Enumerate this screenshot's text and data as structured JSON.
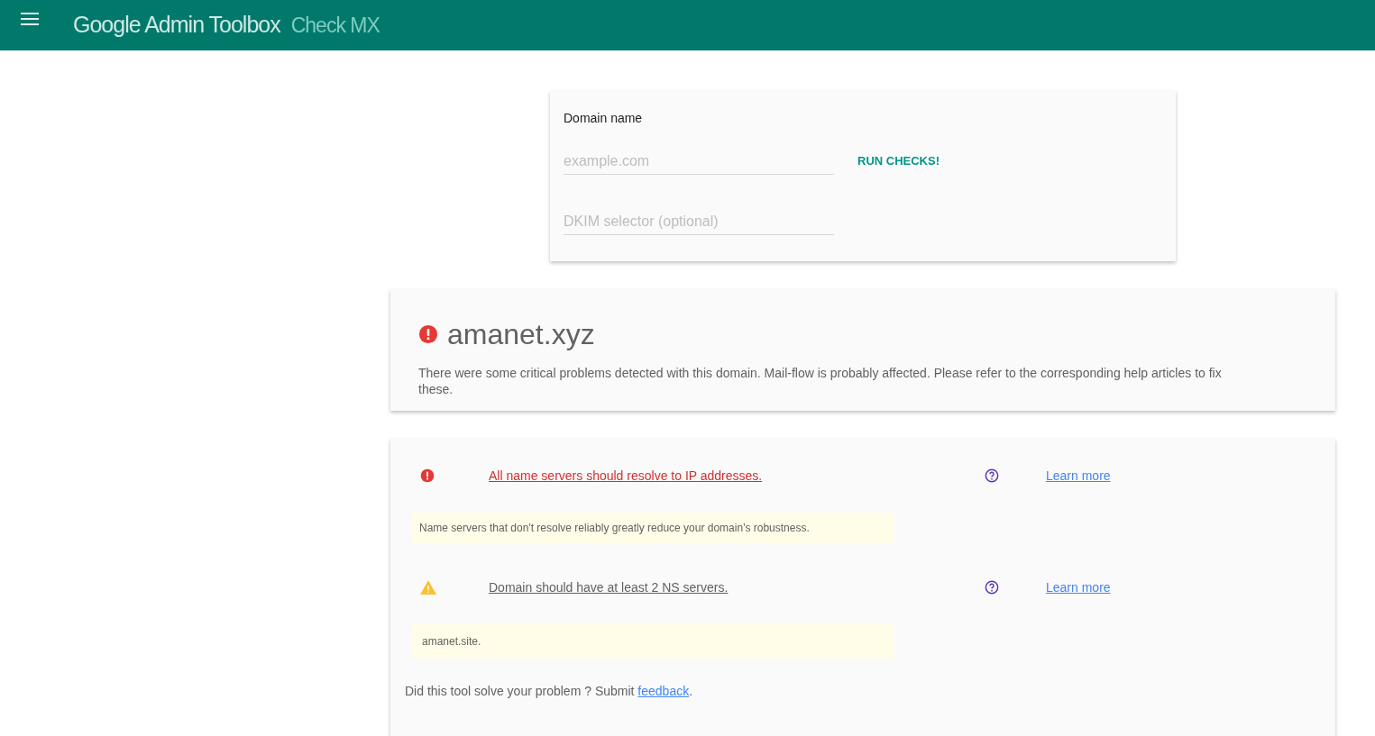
{
  "header": {
    "title": "Google Admin Toolbox",
    "subtitle": "Check MX"
  },
  "form": {
    "label": "Domain name",
    "domain_placeholder": "example.com",
    "run_button": "RUN CHECKS!",
    "dkim_placeholder": "DKIM selector (optional)"
  },
  "summary": {
    "domain": "amanet.xyz",
    "kind": "error",
    "message": "There were some critical problems detected with this domain. Mail-flow is probably affected. Please refer to the corresponding help articles to fix these."
  },
  "checks": [
    {
      "kind": "error",
      "title": "All name servers should resolve to IP addresses.",
      "link": "Learn more",
      "detail": "Name servers that don't resolve reliably greatly reduce your domain's robustness."
    },
    {
      "kind": "warning",
      "title": "Domain should have at least 2 NS servers.",
      "link": "Learn more",
      "detail": "amanet.site."
    }
  ],
  "feedback": {
    "prefix": "Did this tool solve your problem ? Submit ",
    "link": "feedback",
    "suffix": "."
  }
}
